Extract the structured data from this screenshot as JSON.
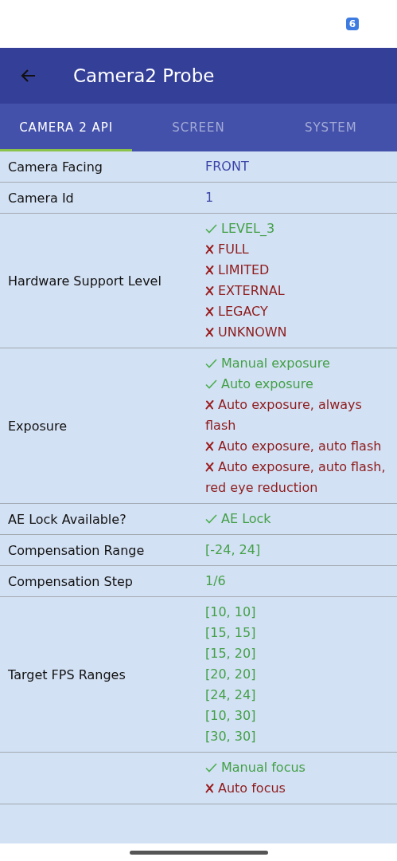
{
  "status_bar": {
    "badge": "6"
  },
  "app_bar": {
    "title": "Camera2 Probe"
  },
  "tabs": [
    {
      "label": "CAMERA 2 API",
      "selected": true
    },
    {
      "label": "SCREEN",
      "selected": false
    },
    {
      "label": "SYSTEM",
      "selected": false
    }
  ],
  "rows": [
    {
      "label": "Camera Facing",
      "values": [
        {
          "kind": "plain",
          "text": "FRONT"
        }
      ]
    },
    {
      "label": "Camera Id",
      "values": [
        {
          "kind": "plain",
          "text": "1"
        }
      ]
    },
    {
      "label": "Hardware Support Level",
      "values": [
        {
          "kind": "feature",
          "text": "LEVEL_3",
          "supported": true
        },
        {
          "kind": "feature",
          "text": "FULL",
          "supported": false
        },
        {
          "kind": "feature",
          "text": "LIMITED",
          "supported": false
        },
        {
          "kind": "feature",
          "text": "EXTERNAL",
          "supported": false
        },
        {
          "kind": "feature",
          "text": "LEGACY",
          "supported": false
        },
        {
          "kind": "feature",
          "text": "UNKNOWN",
          "supported": false
        }
      ]
    },
    {
      "label": "Exposure",
      "values": [
        {
          "kind": "feature",
          "text": "Manual exposure",
          "supported": true
        },
        {
          "kind": "feature",
          "text": "Auto exposure",
          "supported": true
        },
        {
          "kind": "feature",
          "text": "Auto exposure, always flash",
          "supported": false
        },
        {
          "kind": "feature",
          "text": "Auto exposure, auto flash",
          "supported": false
        },
        {
          "kind": "feature",
          "text": "Auto exposure, auto flash, red eye reduction",
          "supported": false
        }
      ]
    },
    {
      "label": "AE Lock Available?",
      "values": [
        {
          "kind": "feature",
          "text": "AE Lock",
          "supported": true
        }
      ]
    },
    {
      "label": "Compensation Range",
      "values": [
        {
          "kind": "value",
          "text": "[-24, 24]"
        }
      ]
    },
    {
      "label": "Compensation Step",
      "values": [
        {
          "kind": "value",
          "text": "1/6"
        }
      ]
    },
    {
      "label": "Target FPS Ranges",
      "values": [
        {
          "kind": "value",
          "text": "[10, 10]"
        },
        {
          "kind": "value",
          "text": "[15, 15]"
        },
        {
          "kind": "value",
          "text": "[15, 20]"
        },
        {
          "kind": "value",
          "text": "[20, 20]"
        },
        {
          "kind": "value",
          "text": "[24, 24]"
        },
        {
          "kind": "value",
          "text": "[10, 30]"
        },
        {
          "kind": "value",
          "text": "[30, 30]"
        }
      ]
    },
    {
      "values": [
        {
          "kind": "feature",
          "text": "Manual focus",
          "supported": true
        },
        {
          "kind": "feature",
          "text": "Auto focus",
          "supported": false
        }
      ]
    }
  ]
}
